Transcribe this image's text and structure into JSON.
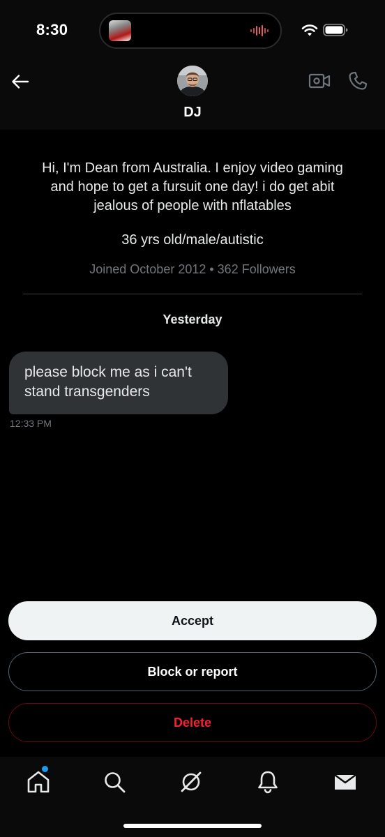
{
  "status_bar": {
    "time": "8:30"
  },
  "header": {
    "name": "DJ"
  },
  "profile": {
    "bio_lines": [
      "Hi, I'm Dean from Australia. I enjoy video gaming",
      "and hope to get a fursuit one day!  i do get abit",
      "jealous of people with nflatables"
    ],
    "tags": "36 yrs old/male/autistic",
    "meta": "Joined October 2012 • 362 Followers"
  },
  "conversation": {
    "date_label": "Yesterday",
    "message": {
      "lines": [
        "please block me as i can't",
        "stand transgenders"
      ],
      "time": "12:33 PM"
    }
  },
  "actions": {
    "accept_label": "Accept",
    "block_label": "Block or report",
    "delete_label": "Delete"
  },
  "bottom_nav": {
    "items": [
      "home-icon",
      "search-icon",
      "grok-icon",
      "bell-icon",
      "mail-icon"
    ],
    "home_has_notification": true
  },
  "colors": {
    "background": "#000000",
    "bubble": "#2f3336",
    "muted_text": "#71767b",
    "danger": "#f4212e",
    "accent": "#1d9bf0"
  }
}
